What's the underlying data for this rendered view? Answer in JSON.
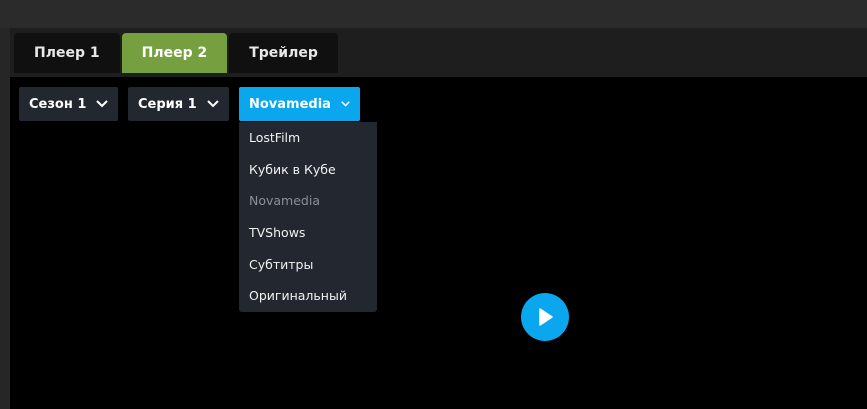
{
  "tabs": [
    {
      "label": "Плеер 1"
    },
    {
      "label": "Плеер 2"
    },
    {
      "label": "Трейлер"
    }
  ],
  "active_tab": "Плеер 2",
  "selects": {
    "season": {
      "value": "Сезон 1"
    },
    "episode": {
      "value": "Серия 1"
    },
    "translation": {
      "value": "Novamedia"
    }
  },
  "translation_options": [
    {
      "label": "LostFilm"
    },
    {
      "label": "Кубик в Кубе"
    },
    {
      "label": "Novamedia"
    },
    {
      "label": "TVShows"
    },
    {
      "label": "Субтитры"
    },
    {
      "label": "Оригинальный"
    }
  ],
  "icons": {
    "chevron": "chevron-down-icon",
    "play": "play-icon"
  },
  "colors": {
    "active_tab": "#76a03f",
    "accent": "#0aa7ee",
    "select_bg": "#23272f"
  }
}
